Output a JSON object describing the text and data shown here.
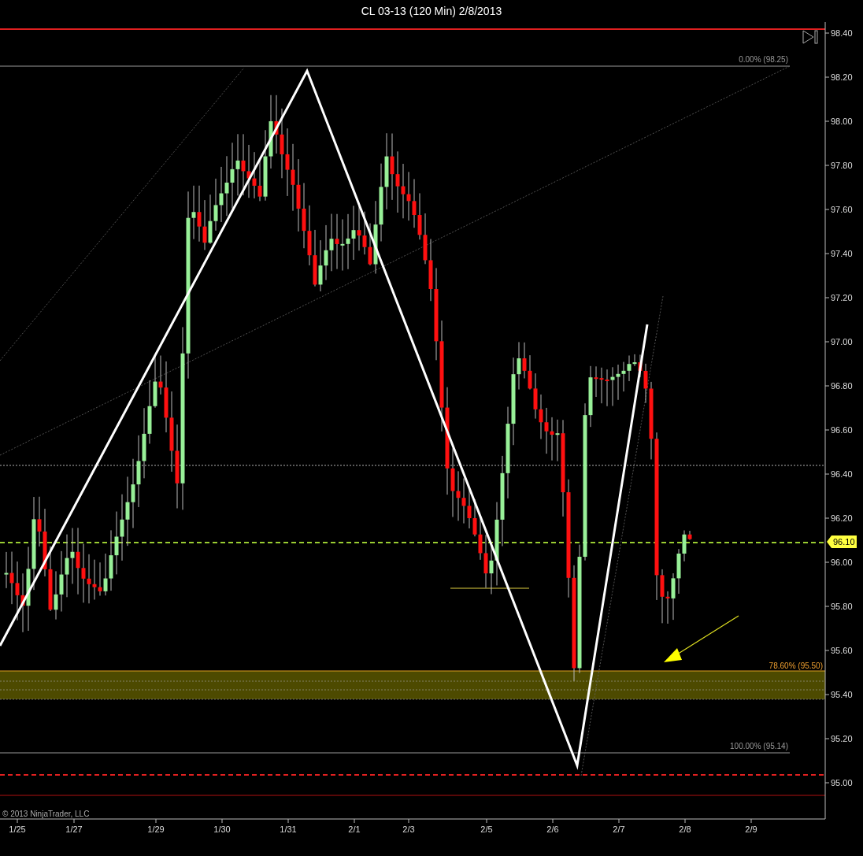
{
  "window": {
    "title": "CL 03-13 (120 Min)  2/8/2013"
  },
  "y_axis": {
    "labels": [
      "98.40",
      "98.20",
      "98.00",
      "97.80",
      "97.60",
      "97.40",
      "97.20",
      "97.00",
      "96.80",
      "96.60",
      "96.40",
      "96.20",
      "96.00",
      "95.80",
      "95.60",
      "95.40",
      "95.20",
      "95.00"
    ]
  },
  "x_axis": {
    "labels": [
      "1/25",
      "1/27",
      "1/29",
      "1/30",
      "1/31",
      "2/1",
      "2/3",
      "2/5",
      "2/6",
      "2/7",
      "2/8",
      "2/9"
    ]
  },
  "fib_levels": [
    {
      "label": "0.00% (98.25)",
      "kind": "top"
    },
    {
      "label": "78.60% (95.50)",
      "kind": "zone"
    },
    {
      "label": "100.00% (95.14)",
      "kind": "bottom"
    }
  ],
  "price_marker": {
    "label": "96.10"
  },
  "copyright": "© 2013 NinjaTrader, LLC"
}
